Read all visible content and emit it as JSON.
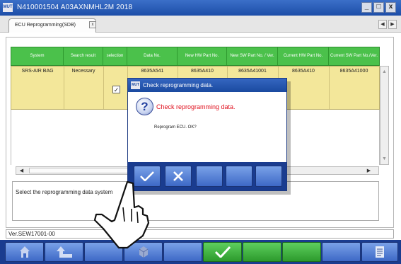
{
  "window": {
    "title": "N410001504  A03AXNMHL2M 2018",
    "icon_text": "MUT",
    "buttons": [
      "_",
      "□",
      "x"
    ]
  },
  "tab": {
    "label": "ECU Reprogramming(SDB)",
    "close_glyph": "x",
    "prev_glyph": "◀",
    "next_glyph": "▶"
  },
  "table": {
    "headers": [
      "System",
      "Search result",
      "selection",
      "Data No.",
      "New HW Part No.",
      "New SW Part No. / Ver.",
      "Current HW Part No.",
      "Current SW Part No./Ver."
    ],
    "rows": [
      {
        "system": "SRS-AIR BAG",
        "search_result": "Necessary",
        "selection_checked": "✓",
        "data_no": "8635A541",
        "new_hw": "8635A410",
        "new_sw": "8635A41001",
        "current_hw": "8635A410",
        "current_sw": "8635A41000"
      }
    ]
  },
  "message_box": {
    "text": "Select the reprogramming data system"
  },
  "status": {
    "version": "Ver.SEW17001-00"
  },
  "dialog": {
    "title": "Check reprogramming data.",
    "heading": "Check reprogramming data.",
    "message": "Reprogram ECU. OK?",
    "icon_text": "MUT",
    "question_glyph": "?"
  },
  "icons": {
    "ok": "checkmark-icon",
    "cancel": "x-icon",
    "home": "home-icon",
    "back": "back-arrow-icon",
    "ecu": "ecu-icon",
    "report": "report-icon",
    "cursor": "hand-cursor-icon"
  },
  "colors": {
    "header_green": "#4bc14b",
    "row_yellow": "#f3e79a",
    "toolbar_blue": "#1a3c8f",
    "title_blue": "#1d4ea8",
    "heading_red": "#e0101e"
  }
}
